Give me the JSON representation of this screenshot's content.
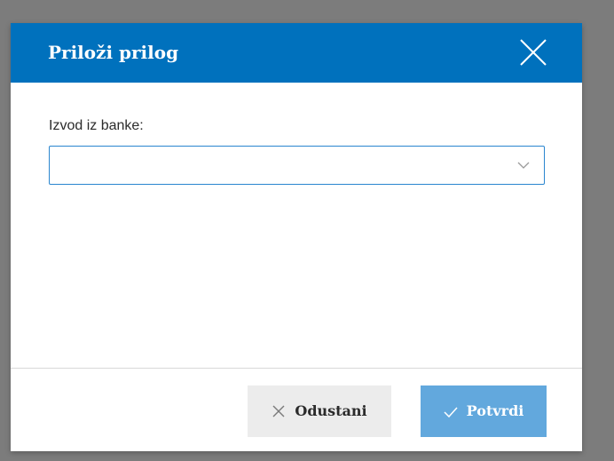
{
  "dialog": {
    "title": "Priloži prilog",
    "close_icon": "close-icon",
    "header_color": "#0071bd"
  },
  "form": {
    "bank_statement_label": "Izvod iz banke:",
    "bank_statement_value": "",
    "dropdown_icon": "chevron-down-icon",
    "border_color": "#2a86cf"
  },
  "footer": {
    "cancel_label": "Odustani",
    "cancel_icon": "close-icon",
    "confirm_label": "Potvrdi",
    "confirm_icon": "checkmark-icon",
    "confirm_color": "#62a8dd"
  }
}
